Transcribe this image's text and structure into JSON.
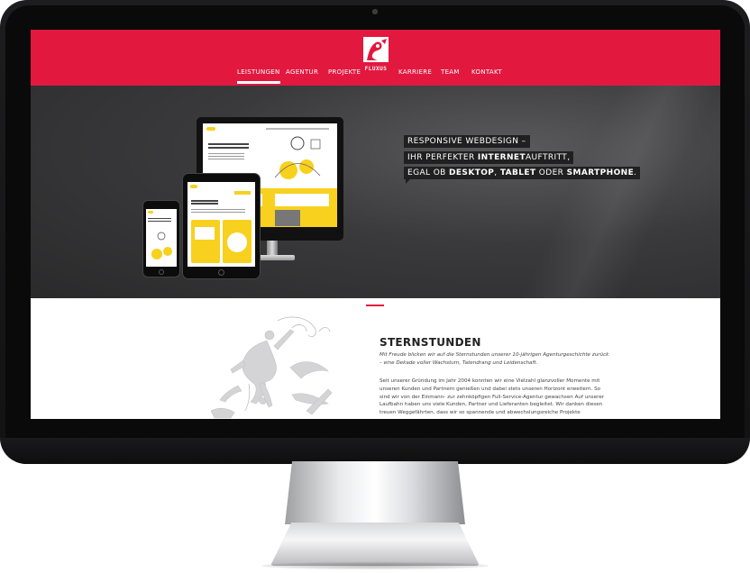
{
  "header": {
    "logo_text": "FLUXUS",
    "nav": [
      {
        "label": "LEISTUNGEN",
        "active": true
      },
      {
        "label": "AGENTUR",
        "active": false
      },
      {
        "label": "PROJEKTE",
        "active": false
      },
      {
        "label": "KARRIERE",
        "active": false
      },
      {
        "label": "TEAM",
        "active": false
      },
      {
        "label": "KONTAKT",
        "active": false
      }
    ]
  },
  "hero": {
    "line1_a": "RESPONSIVE WEBDESIGN –",
    "line2_a": "IHR PERFEKTER ",
    "line2_b": "INTERNET",
    "line2_c": "AUFTRITT,",
    "line3_a": "EGAL OB ",
    "line3_b": "DESKTOP",
    "line3_c": ", ",
    "line3_d": "TABLET",
    "line3_e": " ODER ",
    "line3_f": "SMARTPHONE",
    "line3_g": "."
  },
  "content": {
    "title": "STERNSTUNDEN",
    "intro": "Mit Freude blicken wir auf die Sternstunden unserer 10-jährigen Agenturgeschichte zurück – eine Dekade voller Wachstum, Tatendrang und Leidenschaft.",
    "body": "Seit unserer Gründung im Jahr 2004 konnten wir eine Vielzahl glanzvoller Momente mit unseren Kunden und Partnern genießen und dabei stets unseren Horizont erweitern. So sind wir von der Einmann- zur zehnköpfigen Full-Service-Agentur gewachsen Auf unserer Laufbahn haben uns viele Kunden, Partner und Lieferanten begleitet. Wir danken diesen treuen Weggefährten, dass wir so spannende und abwechslungsreiche Projekte"
  },
  "colors": {
    "brand_red": "#e3183f",
    "accent_yellow": "#f7d11e"
  }
}
